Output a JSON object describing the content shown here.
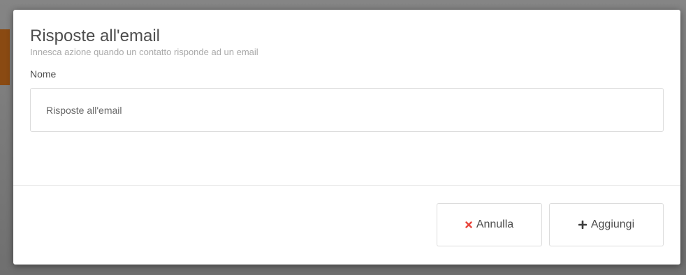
{
  "modal": {
    "title": "Risposte all'email",
    "subtitle": "Innesca azione quando un contatto risponde ad un email",
    "name_field": {
      "label": "Nome",
      "value": "Risposte all'email"
    },
    "buttons": {
      "cancel_label": "Annulla",
      "cancel_icon": "close-icon",
      "add_label": "Aggiungi",
      "add_icon": "plus-icon"
    }
  },
  "colors": {
    "cancel_icon": "#e8453c",
    "text": "#4d4d4d",
    "subtitle": "#a9a9a9"
  }
}
